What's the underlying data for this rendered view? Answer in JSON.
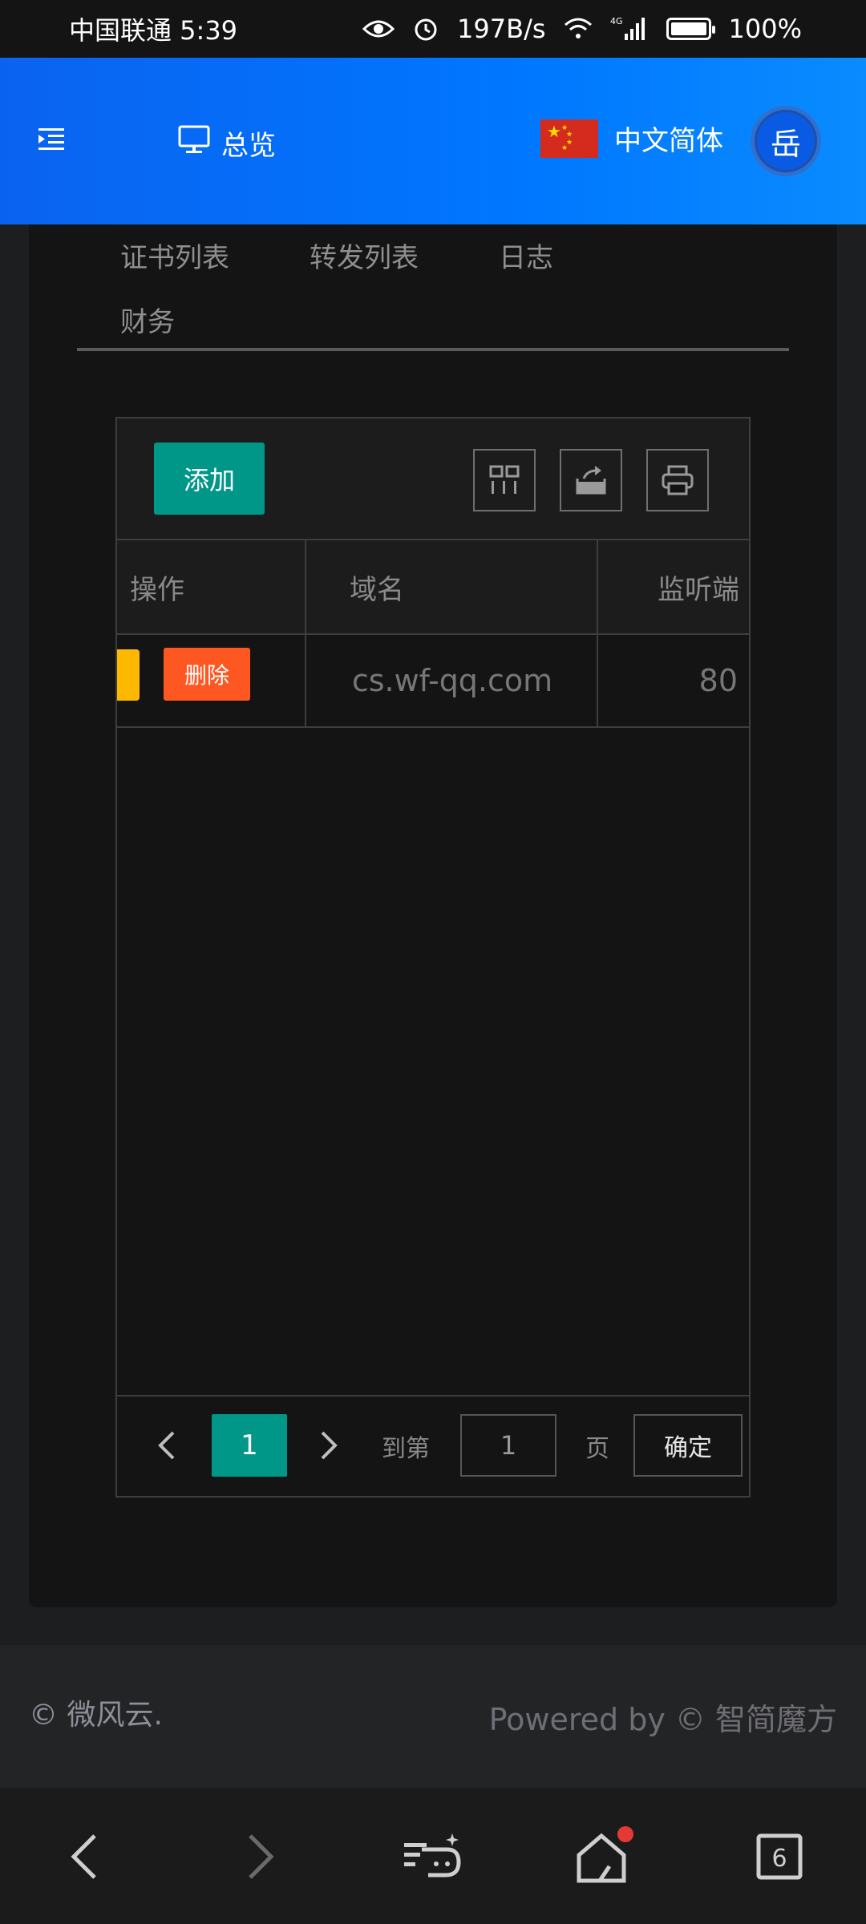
{
  "status_bar": {
    "carrier_time": "中国联通 5:39",
    "speed": "197B/s",
    "network": "4G",
    "battery": "100%",
    "battery_level": 1.0
  },
  "header": {
    "overview_label": "总览",
    "language_label": "中文简体",
    "avatar_text": "岳"
  },
  "tabs": {
    "row1": [
      "证书列表",
      "转发列表",
      "日志"
    ],
    "row2": [
      "财务"
    ]
  },
  "toolbar": {
    "add_label": "添加"
  },
  "table": {
    "columns": [
      "操作",
      "域名",
      "监听端"
    ],
    "rows": [
      {
        "delete_label": "删除",
        "domain": "cs.wf-qq.com",
        "port": "80"
      }
    ]
  },
  "pager": {
    "current_page": "1",
    "goto_label": "到第",
    "page_input_value": "1",
    "page_unit": "页",
    "confirm_label": "确定"
  },
  "footer": {
    "copyright": "© 微风云.",
    "powered": "Powered by © 智简魔方"
  },
  "navbar": {
    "tabs_count": "6"
  }
}
